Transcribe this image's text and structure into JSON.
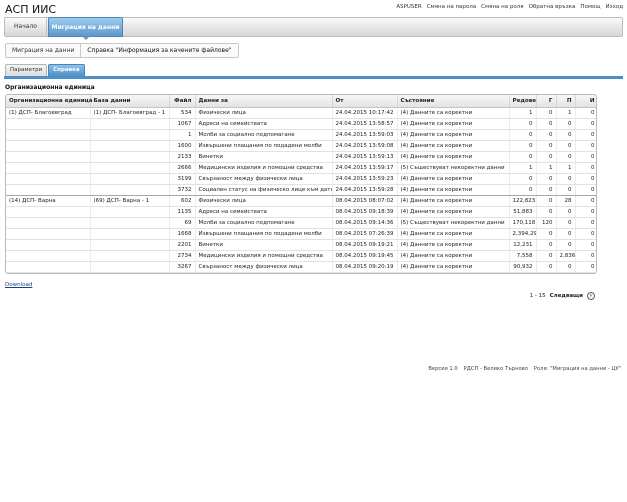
{
  "app": {
    "title": "АСП ИИС"
  },
  "top_links": [
    "ASPUSER",
    "Смяна на парола",
    "Смяна на роля",
    "Обратна връзка",
    "Помощ",
    "Изход"
  ],
  "nav": {
    "home": "Начало",
    "active": "Миграция на данни"
  },
  "breadcrumb": {
    "parent": "Миграция на данни",
    "current": "Справка \"Информация за качените файлове\""
  },
  "tabs": {
    "params": "Параметри",
    "report": "Справка"
  },
  "section": {
    "title": "Организационна единица"
  },
  "table": {
    "headers": {
      "org": "Организационна единица",
      "db": "База данни",
      "file": "Файл",
      "data": "Данни за",
      "from": "От",
      "status": "Състояние",
      "rows": "Редове",
      "g": "Г",
      "p": "П",
      "i": "И"
    },
    "rows": [
      {
        "org": "(1) ДСП- Благоевград",
        "db": "(1) ДСП- Благоевград - 1",
        "file": "534",
        "data": "Физически лица",
        "from": "24.04.2015 10:17:42",
        "status": "(4) Данните са коректни",
        "rows": "1",
        "g": "0",
        "p": "1",
        "i": "0"
      },
      {
        "org": "",
        "db": "",
        "file": "1067",
        "data": "Адреси на семействата",
        "from": "24.04.2015 13:58:57",
        "status": "(4) Данните са коректни",
        "rows": "0",
        "g": "0",
        "p": "0",
        "i": "0"
      },
      {
        "org": "",
        "db": "",
        "file": "1",
        "data": "Молби за социално подпомагане",
        "from": "24.04.2015 13:59:03",
        "status": "(4) Данните са коректни",
        "rows": "0",
        "g": "0",
        "p": "0",
        "i": "0"
      },
      {
        "org": "",
        "db": "",
        "file": "1600",
        "data": "Извършени плащания по подадени молби",
        "from": "24.04.2015 13:59:08",
        "status": "(4) Данните са коректни",
        "rows": "0",
        "g": "0",
        "p": "0",
        "i": "0"
      },
      {
        "org": "",
        "db": "",
        "file": "2133",
        "data": "Винетки",
        "from": "24.04.2015 13:59:13",
        "status": "(4) Данните са коректни",
        "rows": "0",
        "g": "0",
        "p": "0",
        "i": "0"
      },
      {
        "org": "",
        "db": "",
        "file": "2666",
        "data": "Медицински изделия и помощни средства",
        "from": "24.04.2015 13:59:17",
        "status": "(5) Съществуват некоректни данни",
        "rows": "1",
        "g": "1",
        "p": "1",
        "i": "0"
      },
      {
        "org": "",
        "db": "",
        "file": "3199",
        "data": "Свързаност между физически лица",
        "from": "24.04.2015 13:59:23",
        "status": "(4) Данните са коректни",
        "rows": "0",
        "g": "0",
        "p": "0",
        "i": "0"
      },
      {
        "org": "",
        "db": "",
        "file": "3732",
        "data": "Социален статус на физическо лице към дата",
        "from": "24.04.2015 13:59:28",
        "status": "(4) Данните са коректни",
        "rows": "0",
        "g": "0",
        "p": "0",
        "i": "0"
      },
      {
        "org": "(14) ДСП- Варна",
        "db": "(69) ДСП- Варна - 1",
        "file": "602",
        "data": "Физически лица",
        "from": "08.04.2015 08:07:02",
        "status": "(4) Данните са коректни",
        "rows": "122,823",
        "g": "0",
        "p": "28",
        "i": "0"
      },
      {
        "org": "",
        "db": "",
        "file": "1135",
        "data": "Адреси на семействата",
        "from": "08.04.2015 09:18:39",
        "status": "(4) Данните са коректни",
        "rows": "51,883",
        "g": "0",
        "p": "0",
        "i": "0"
      },
      {
        "org": "",
        "db": "",
        "file": "69",
        "data": "Молби за социално подпомагане",
        "from": "08.04.2015 09:14:36",
        "status": "(5) Съществуват некоректни данни",
        "rows": "170,118",
        "g": "120",
        "p": "0",
        "i": "0"
      },
      {
        "org": "",
        "db": "",
        "file": "1668",
        "data": "Извършени плащания по подадени молби",
        "from": "08.04.2015 07:26:39",
        "status": "(4) Данните са коректни",
        "rows": "2,394,298",
        "g": "0",
        "p": "0",
        "i": "0"
      },
      {
        "org": "",
        "db": "",
        "file": "2201",
        "data": "Винетки",
        "from": "08.04.2015 09:19:21",
        "status": "(4) Данните са коректни",
        "rows": "12,231",
        "g": "0",
        "p": "0",
        "i": "0"
      },
      {
        "org": "",
        "db": "",
        "file": "2734",
        "data": "Медицински изделия и помощни средства",
        "from": "08.04.2015 09:19:45",
        "status": "(4) Данните са коректни",
        "rows": "7,558",
        "g": "0",
        "p": "2,836",
        "i": "0"
      },
      {
        "org": "",
        "db": "",
        "file": "3267",
        "data": "Свързаност между физически лица",
        "from": "08.04.2015 09:20:19",
        "status": "(4) Данните са коректни",
        "rows": "90,932",
        "g": "0",
        "p": "0",
        "i": "0"
      }
    ]
  },
  "download": "Download",
  "pager": {
    "range": "1 - 15",
    "next": "Следващи"
  },
  "footer": {
    "version": "Версия 1.0",
    "unit": "РДСП - Велико Търново",
    "role": "Роля: \"Миграция на данни - ЦУ\""
  }
}
